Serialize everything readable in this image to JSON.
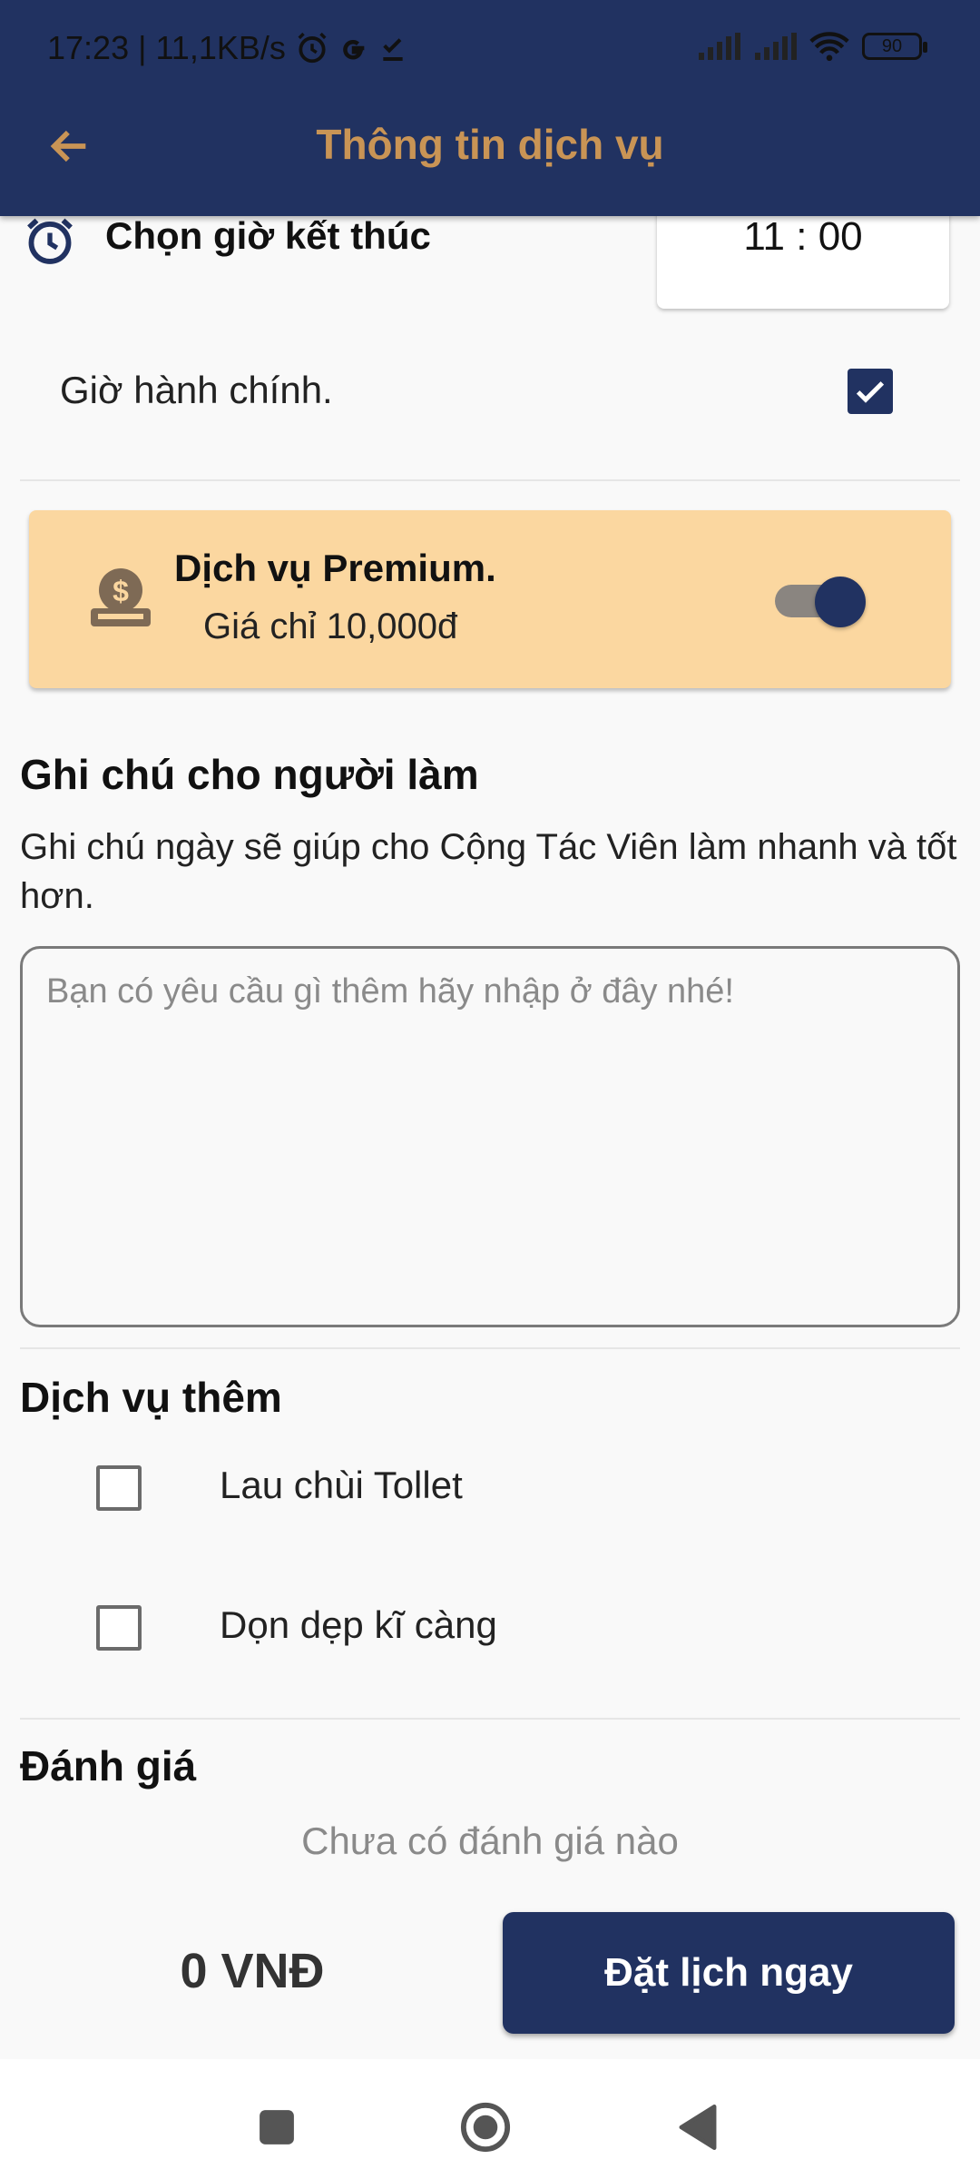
{
  "status_bar": {
    "time_speed": "17:23 | 11,1KB/s",
    "battery": "90"
  },
  "header": {
    "title": "Thông tin dịch vụ"
  },
  "end_time": {
    "label": "Chọn giờ kết thúc",
    "value": "11 : 00"
  },
  "office_hours": {
    "label": "Giờ hành chính.",
    "checked": true
  },
  "premium": {
    "title": "Dịch vụ Premium.",
    "price": "Giá chỉ 10,000đ",
    "enabled": true
  },
  "notes": {
    "title": "Ghi chú cho người làm",
    "description": "Ghi chú ngày sẽ giúp cho Cộng Tác Viên làm nhanh và tốt hơn.",
    "placeholder": "Bạn có yêu cầu gì thêm hãy nhập ở đây nhé!"
  },
  "extras": {
    "title": "Dịch vụ thêm",
    "items": [
      {
        "label": "Lau chùi Tollet",
        "checked": false
      },
      {
        "label": "Dọn dẹp kĩ càng",
        "checked": false
      }
    ]
  },
  "rating": {
    "title": "Đánh giá",
    "empty_text": "Chưa có đánh giá nào"
  },
  "footer": {
    "total": "0 VNĐ",
    "book_label": "Đặt lịch ngay"
  },
  "colors": {
    "primary": "#213261",
    "accent": "#c99455",
    "premium_bg": "#fbd7a0"
  }
}
